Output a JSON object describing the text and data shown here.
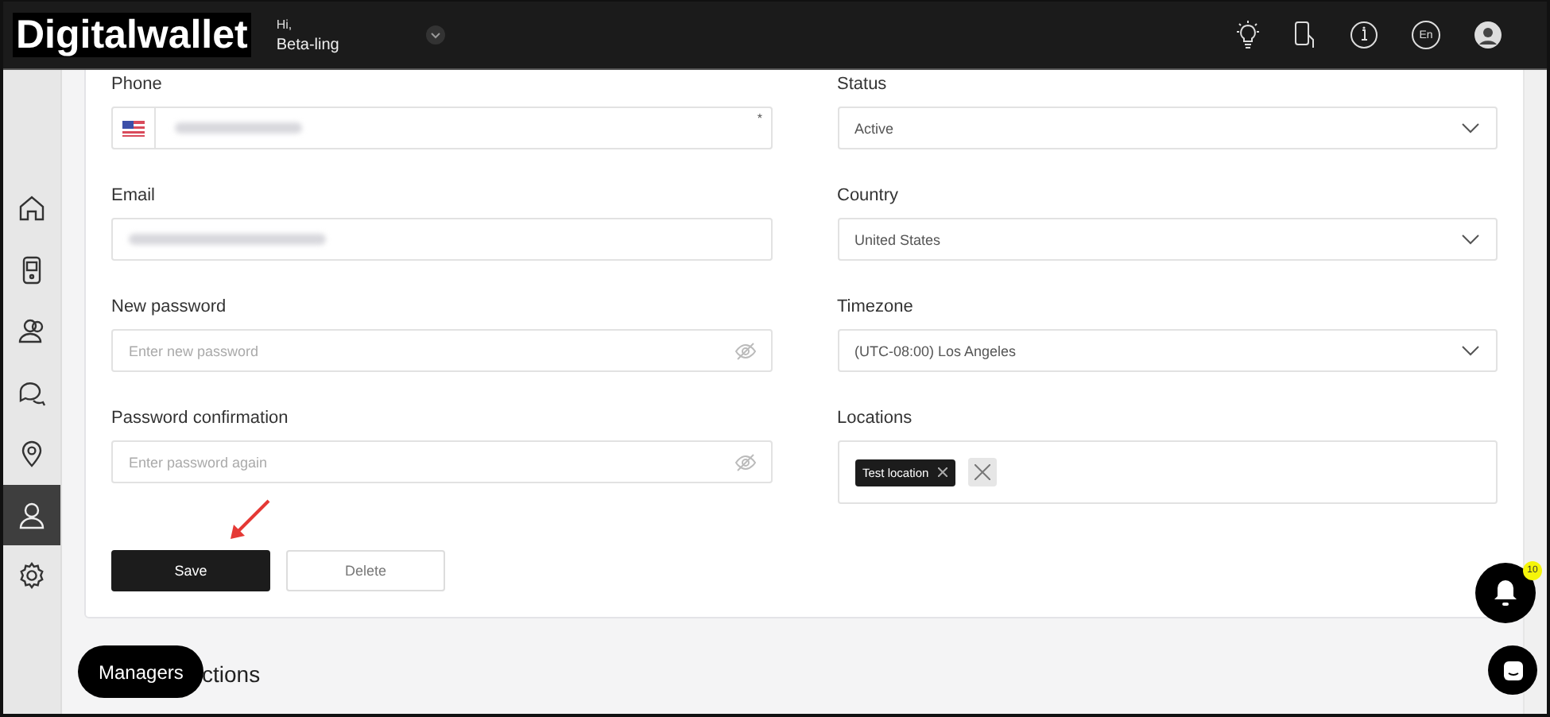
{
  "header": {
    "logo": "Digitalwallet",
    "greeting": "Hi,",
    "user": "Beta-ling",
    "language": "En"
  },
  "sidebar": {
    "items": [
      {
        "selected": false
      },
      {
        "selected": false
      },
      {
        "selected": false
      },
      {
        "selected": false
      },
      {
        "selected": false
      },
      {
        "selected": true
      },
      {
        "selected": false
      }
    ]
  },
  "form": {
    "left": [
      {
        "kind": "phone",
        "label": "Phone",
        "required_mark": "*"
      },
      {
        "kind": "blurred",
        "label": "Email"
      },
      {
        "kind": "password",
        "label": "New password",
        "placeholder": "Enter new password"
      },
      {
        "kind": "password",
        "label": "Password confirmation",
        "placeholder": "Enter password again"
      }
    ],
    "right": [
      {
        "kind": "select",
        "label": "Status",
        "value": "Active"
      },
      {
        "kind": "select",
        "label": "Country",
        "value": "United States"
      },
      {
        "kind": "select",
        "label": "Timezone",
        "value": "(UTC-08:00) Los Angeles"
      },
      {
        "kind": "tags",
        "label": "Locations",
        "tags": [
          "Test location"
        ]
      }
    ],
    "buttons": [
      {
        "label": "Save",
        "kind": "primary"
      },
      {
        "label": "Delete",
        "kind": "secondary"
      }
    ]
  },
  "section_title": "ctions",
  "tooltip": "Managers",
  "notifications": {
    "count": "10"
  }
}
